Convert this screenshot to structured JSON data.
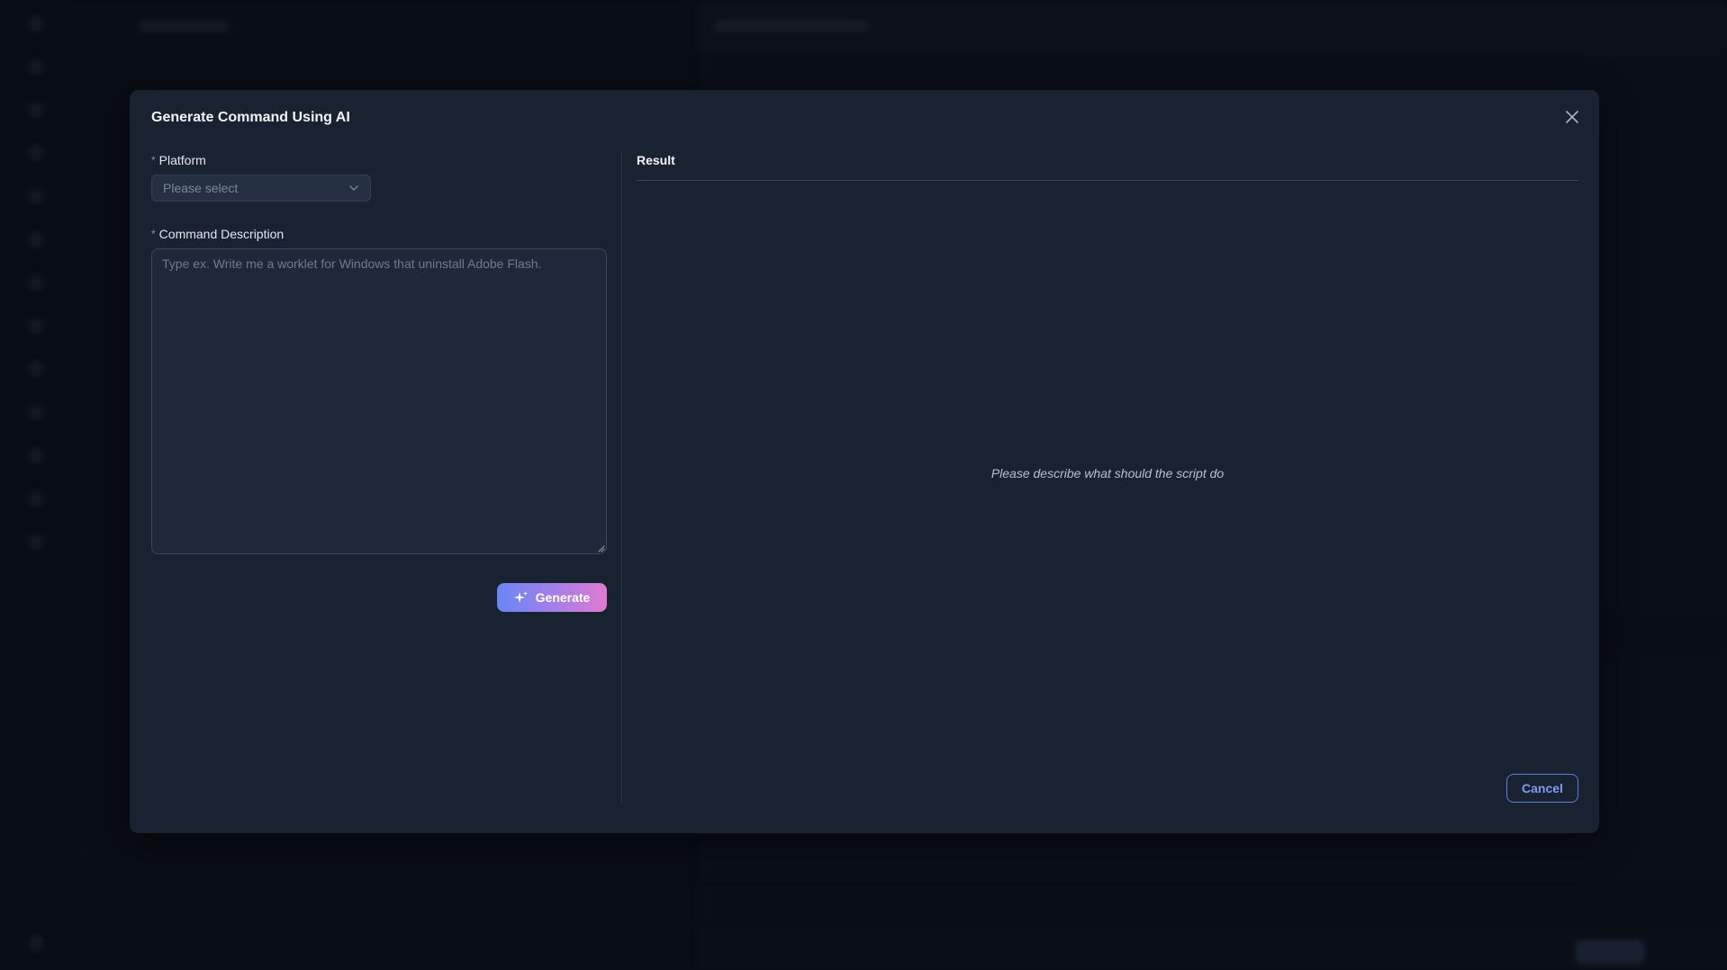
{
  "modal": {
    "title": "Generate Command Using AI",
    "platform": {
      "label": "Platform",
      "required_mark": "*",
      "placeholder": "Please select",
      "value": ""
    },
    "description": {
      "label": "Command Description",
      "required_mark": "*",
      "placeholder": "Type ex. Write me a worklet for Windows that uninstall Adobe Flash.",
      "value": ""
    },
    "generate_label": "Generate",
    "result": {
      "label": "Result",
      "empty_message": "Please describe what should the script do"
    },
    "cancel_label": "Cancel"
  },
  "colors": {
    "modal_bg": "#192231",
    "accent": "#7b9cf0",
    "gradient_start": "#6a86f5",
    "gradient_end": "#e07bcf"
  },
  "icons": {
    "close": "close-icon",
    "select_chevron": "chevron-down-icon",
    "generate": "sparkle-icon",
    "resize": "resize-grip-icon"
  }
}
